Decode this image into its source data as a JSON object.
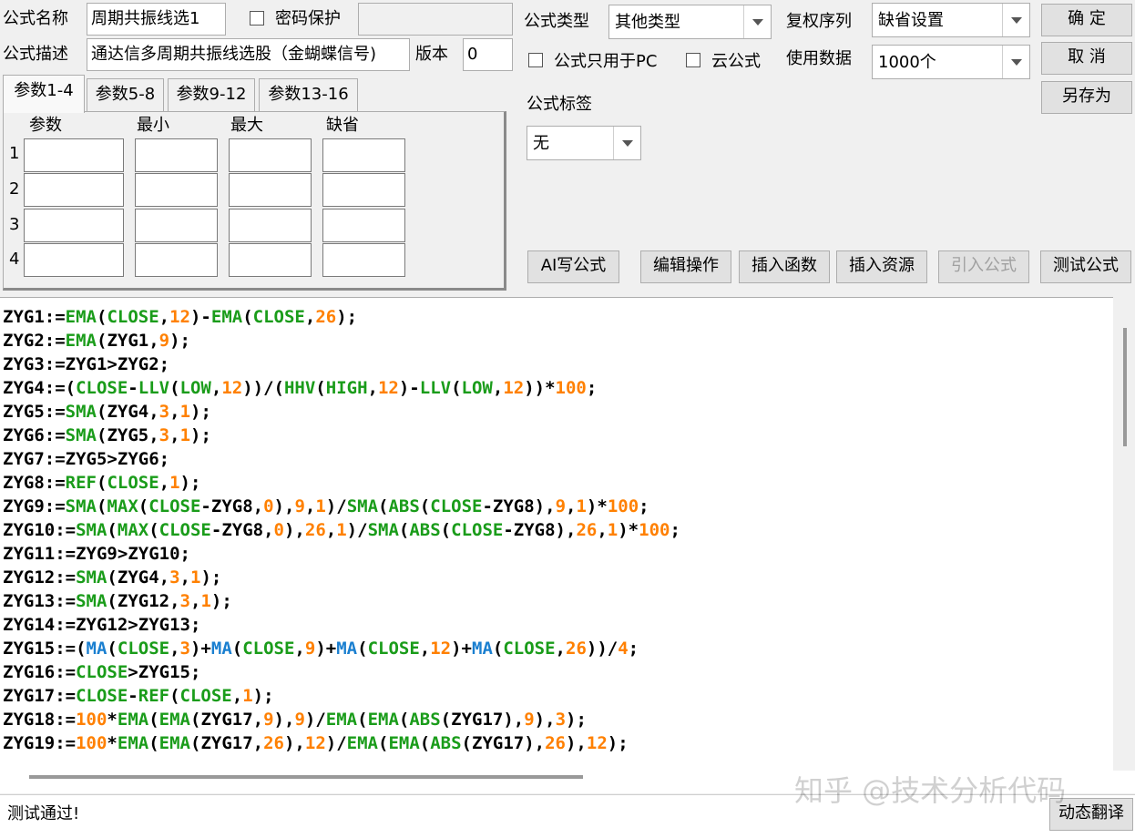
{
  "form": {
    "name_label": "公式名称",
    "name_value": "周期共振线选1",
    "password_label": "密码保护",
    "password_value": "",
    "desc_label": "公式描述",
    "desc_value": "通达信多周期共振线选股（金蝴蝶信号)",
    "version_label": "版本",
    "version_value": "0",
    "type_label": "公式类型",
    "type_value": "其他类型",
    "pc_only_label": "公式只用于PC",
    "cloud_label": "云公式",
    "rights_label": "复权序列",
    "rights_value": "缺省设置",
    "data_label": "使用数据",
    "data_value": "1000个",
    "tag_label": "公式标签",
    "tag_value": "无"
  },
  "buttons": {
    "ok": "确 定",
    "cancel": "取 消",
    "save_as": "另存为",
    "ai": "AI写公式",
    "edit": "编辑操作",
    "insert_func": "插入函数",
    "insert_res": "插入资源",
    "import": "引入公式",
    "test": "测试公式",
    "translate": "动态翻译"
  },
  "params": {
    "tabs": [
      "参数1-4",
      "参数5-8",
      "参数9-12",
      "参数13-16"
    ],
    "headers": [
      "参数",
      "最小",
      "最大",
      "缺省"
    ],
    "rows": [
      "1",
      "2",
      "3",
      "4"
    ]
  },
  "code_lines": [
    "ZYG1:=EMA(CLOSE,12)-EMA(CLOSE,26);",
    "ZYG2:=EMA(ZYG1,9);",
    "ZYG3:=ZYG1>ZYG2;",
    "ZYG4:=(CLOSE-LLV(LOW,12))/(HHV(HIGH,12)-LLV(LOW,12))*100;",
    "ZYG5:=SMA(ZYG4,3,1);",
    "ZYG6:=SMA(ZYG5,3,1);",
    "ZYG7:=ZYG5>ZYG6;",
    "ZYG8:=REF(CLOSE,1);",
    "ZYG9:=SMA(MAX(CLOSE-ZYG8,0),9,1)/SMA(ABS(CLOSE-ZYG8),9,1)*100;",
    "ZYG10:=SMA(MAX(CLOSE-ZYG8,0),26,1)/SMA(ABS(CLOSE-ZYG8),26,1)*100;",
    "ZYG11:=ZYG9>ZYG10;",
    "ZYG12:=SMA(ZYG4,3,1);",
    "ZYG13:=SMA(ZYG12,3,1);",
    "ZYG14:=ZYG12>ZYG13;",
    "ZYG15:=(MA(CLOSE,3)+MA(CLOSE,9)+MA(CLOSE,12)+MA(CLOSE,26))/4;",
    "ZYG16:=CLOSE>ZYG15;",
    "ZYG17:=CLOSE-REF(CLOSE,1);",
    "ZYG18:=100*EMA(EMA(ZYG17,9),9)/EMA(EMA(ABS(ZYG17),9),3);",
    "ZYG19:=100*EMA(EMA(ZYG17,26),12)/EMA(EMA(ABS(ZYG17),26),12);"
  ],
  "status": "测试通过!",
  "watermark": "知乎 @技术分析代码",
  "colors": {
    "function": "#1a9c1a",
    "number": "#ff8000",
    "ma": "#1a7fd0",
    "text": "#000000"
  }
}
